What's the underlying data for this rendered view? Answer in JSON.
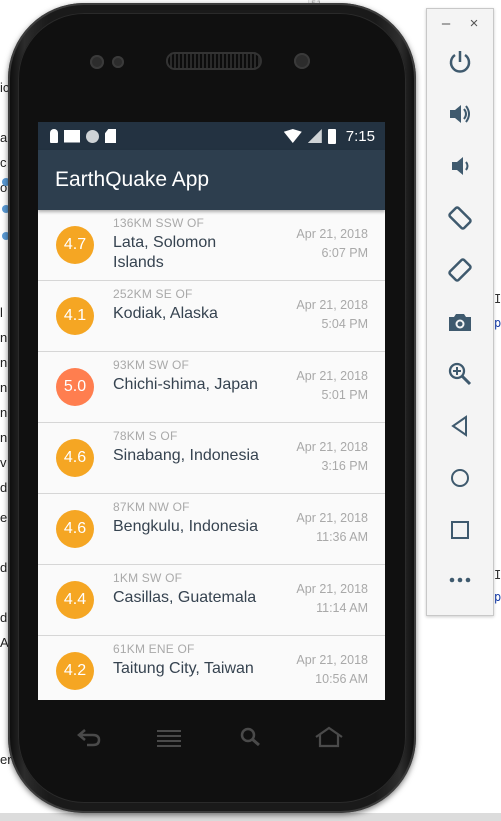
{
  "background": {
    "left_fragments": [
      "ic",
      "a",
      "c",
      "o",
      "l",
      "n",
      "n",
      "n",
      "n",
      "n",
      "v",
      "d",
      "e",
      "d",
      "d",
      "App",
      "erties"
    ],
    "right_fragments": [
      {
        "text": "I",
        "blue": false
      },
      {
        "text": "p",
        "blue": true
      },
      {
        "text": "I",
        "blue": false
      },
      {
        "text": "p",
        "blue": true
      }
    ],
    "gutter_lines": [
      "51",
      "129"
    ]
  },
  "status_bar": {
    "time": "7:15",
    "icons": [
      "key-icon",
      "mail-icon",
      "circle-icon",
      "sd-card-icon",
      "wifi-icon",
      "signal-icon",
      "battery-icon"
    ]
  },
  "app_bar": {
    "title": "EarthQuake App"
  },
  "earthquakes": [
    {
      "magnitude": "4.7",
      "offset": "136KM SSW OF",
      "place": "Lata, Solomon Islands",
      "date": "Apr 21, 2018",
      "time": "6:07 PM",
      "color": "#f5a623"
    },
    {
      "magnitude": "4.1",
      "offset": "252KM SE OF",
      "place": "Kodiak, Alaska",
      "date": "Apr 21, 2018",
      "time": "5:04 PM",
      "color": "#f5a623"
    },
    {
      "magnitude": "5.0",
      "offset": "93KM SW OF",
      "place": "Chichi-shima, Japan",
      "date": "Apr 21, 2018",
      "time": "5:01 PM",
      "color": "#ff7e4f"
    },
    {
      "magnitude": "4.6",
      "offset": "78KM S OF",
      "place": "Sinabang, Indonesia",
      "date": "Apr 21, 2018",
      "time": "3:16 PM",
      "color": "#f5a623"
    },
    {
      "magnitude": "4.6",
      "offset": "87KM NW OF",
      "place": "Bengkulu, Indonesia",
      "date": "Apr 21, 2018",
      "time": "11:36 AM",
      "color": "#f5a623"
    },
    {
      "magnitude": "4.4",
      "offset": "1KM SW OF",
      "place": "Casillas, Guatemala",
      "date": "Apr 21, 2018",
      "time": "11:14 AM",
      "color": "#f5a623"
    },
    {
      "magnitude": "4.2",
      "offset": "61KM ENE OF",
      "place": "Taitung City, Taiwan",
      "date": "Apr 21, 2018",
      "time": "10:56 AM",
      "color": "#f5a623"
    }
  ],
  "phone_nav": [
    {
      "name": "back-button",
      "icon": "back-icon"
    },
    {
      "name": "menu-button",
      "icon": "menu-icon"
    },
    {
      "name": "search-button",
      "icon": "search-icon"
    },
    {
      "name": "home-button",
      "icon": "home-icon"
    }
  ],
  "emulator_toolbar": {
    "window_buttons": [
      {
        "name": "minimize-button",
        "glyph": "–"
      },
      {
        "name": "close-button",
        "glyph": "×"
      }
    ],
    "tools": [
      {
        "name": "power-button",
        "icon": "power-icon"
      },
      {
        "name": "volume-up-button",
        "icon": "volume-up-icon"
      },
      {
        "name": "volume-down-button",
        "icon": "volume-down-icon"
      },
      {
        "name": "rotate-left-button",
        "icon": "rotate-left-icon"
      },
      {
        "name": "rotate-right-button",
        "icon": "rotate-right-icon"
      },
      {
        "name": "screenshot-button",
        "icon": "camera-icon"
      },
      {
        "name": "zoom-button",
        "icon": "zoom-in-icon"
      },
      {
        "name": "back-nav-button",
        "icon": "triangle-back-icon"
      },
      {
        "name": "home-nav-button",
        "icon": "circle-home-icon"
      },
      {
        "name": "overview-button",
        "icon": "square-overview-icon"
      },
      {
        "name": "more-button",
        "icon": "more-icon"
      }
    ]
  }
}
